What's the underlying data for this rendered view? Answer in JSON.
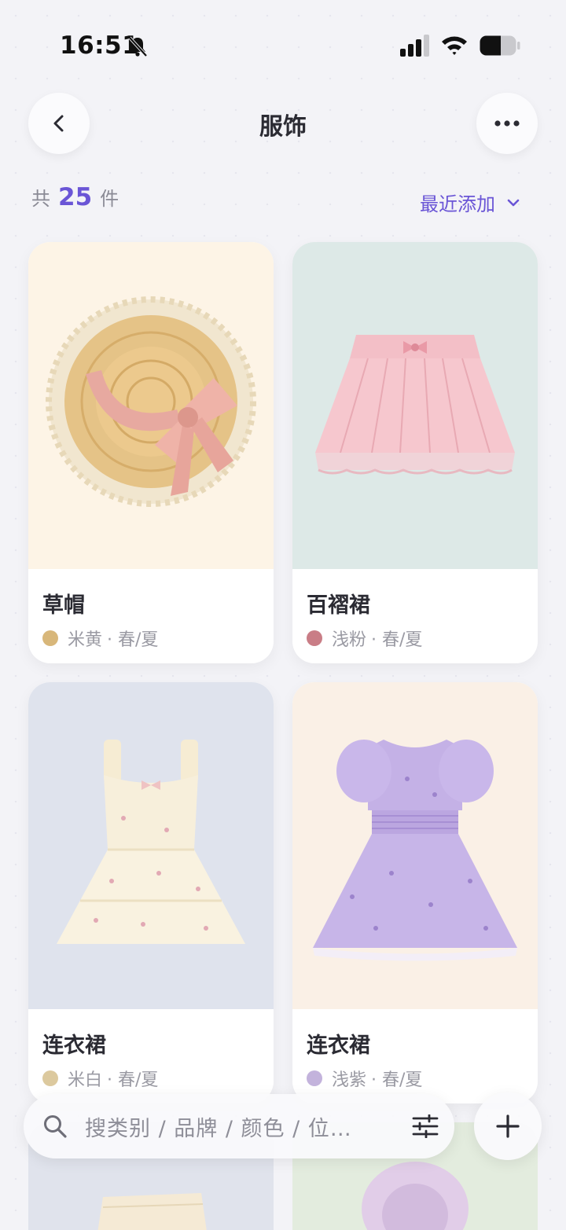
{
  "status_bar": {
    "time": "16:51"
  },
  "header": {
    "title": "服饰"
  },
  "summary": {
    "prefix": "共",
    "count": "25",
    "suffix": "件"
  },
  "sort": {
    "label": "最近添加"
  },
  "items": [
    {
      "name": "草帽",
      "color_name": "米黄",
      "season": "· 春/夏",
      "dot_color": "#d8b77a",
      "bg": "#fdf4e6"
    },
    {
      "name": "百褶裙",
      "color_name": "浅粉",
      "season": "· 春/夏",
      "dot_color": "#c97d86",
      "bg": "#dde9e7"
    },
    {
      "name": "连衣裙",
      "color_name": "米白",
      "season": "· 春/夏",
      "dot_color": "#dcc99e",
      "bg": "#dfe3ed"
    },
    {
      "name": "连衣裙",
      "color_name": "浅紫",
      "season": "· 春/夏",
      "dot_color": "#c3b3dc",
      "bg": "#faf0e6"
    }
  ],
  "search": {
    "placeholder": "搜类别 / 品牌 / 颜色 / 位…"
  },
  "icons": {
    "back": "chevron-left-icon",
    "more": "more-horizontal-icon",
    "search": "search-icon",
    "filter": "sliders-icon",
    "add": "plus-icon"
  },
  "colors": {
    "accent": "#6a55d6",
    "background": "#f3f3f7"
  }
}
